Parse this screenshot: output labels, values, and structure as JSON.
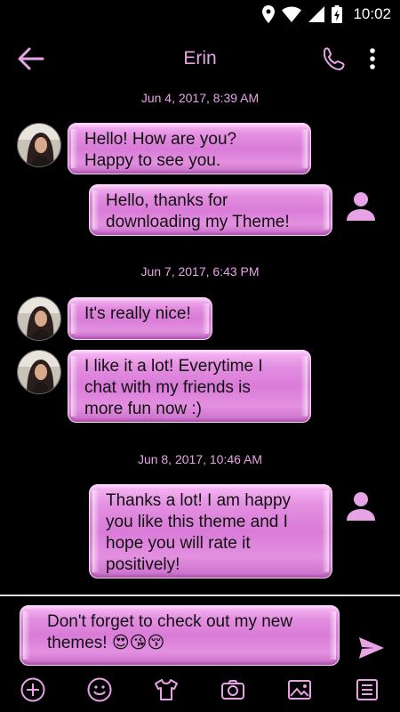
{
  "status_bar": {
    "time": "10:02"
  },
  "app_bar": {
    "contact_name": "Erin"
  },
  "conversation": {
    "dates": [
      "Jun 4, 2017, 8:39 AM",
      "Jun 7, 2017, 6:43 PM",
      "Jun 8, 2017, 10:46 AM"
    ],
    "messages": [
      {
        "sender": "contact",
        "text_lines": [
          "Hello! How are you?",
          "Happy to see you."
        ]
      },
      {
        "sender": "me",
        "text_lines": [
          "Hello, thanks for",
          "downloading my Theme!"
        ]
      },
      {
        "sender": "contact",
        "text_lines": [
          "It's really nice!"
        ]
      },
      {
        "sender": "contact",
        "text_lines": [
          "I like it a lot! Everytime I",
          "chat with my friends is",
          "more fun now :)"
        ]
      },
      {
        "sender": "me",
        "text_lines": [
          "Thanks a lot! I am happy",
          "you like this theme and I",
          "hope you will rate it",
          "positively!"
        ]
      }
    ]
  },
  "composer": {
    "line1": "Don't forget to check out my new",
    "line2": "themes! 😍😘😚"
  },
  "toolbar_icons": [
    "add-icon",
    "emoji-icon",
    "theme-shirt-icon",
    "camera-icon",
    "gallery-icon",
    "list-icon"
  ],
  "colors": {
    "accent": "#e7a3e6",
    "bubble": "#e38fe0",
    "background": "#000000"
  }
}
